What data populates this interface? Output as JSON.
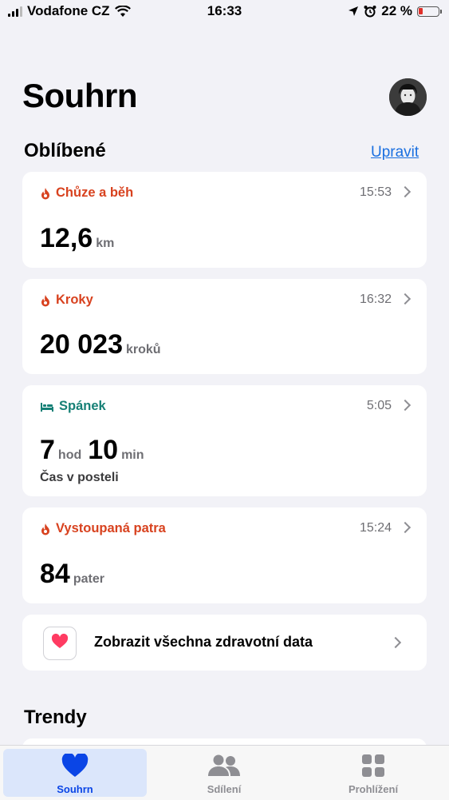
{
  "status_bar": {
    "carrier": "Vodafone CZ",
    "time": "16:33",
    "battery": "22 %",
    "battery_level": 0.22
  },
  "header": {
    "title": "Souhrn"
  },
  "favorites": {
    "title": "Oblíbené",
    "edit_label": "Upravit",
    "cards": [
      {
        "label": "Chůze a běh",
        "time": "15:53",
        "value": "12,6",
        "unit": "km",
        "color": "#d8421f",
        "icon": "flame-icon"
      },
      {
        "label": "Kroky",
        "time": "16:32",
        "value": "20 023",
        "unit": "kroků",
        "color": "#d8421f",
        "icon": "flame-icon"
      },
      {
        "label": "Spánek",
        "time": "5:05",
        "value_hours": "7",
        "unit_hours": "hod",
        "value_minutes": "10",
        "unit_minutes": "min",
        "sub": "Čas v posteli",
        "color": "#168076",
        "icon": "bed-icon"
      },
      {
        "label": "Vystoupaná patra",
        "time": "15:24",
        "value": "84",
        "unit": "pater",
        "color": "#d8421f",
        "icon": "flame-icon"
      }
    ],
    "all_data_label": "Zobrazit všechna zdravotní data"
  },
  "trends": {
    "title": "Trendy"
  },
  "tab_bar": {
    "tabs": [
      {
        "label": "Souhrn",
        "selected": true,
        "icon": "heart-icon"
      },
      {
        "label": "Sdílení",
        "selected": false,
        "icon": "people-icon"
      },
      {
        "label": "Prohlížení",
        "selected": false,
        "icon": "grid-icon"
      }
    ],
    "accent": "#0a45e6"
  }
}
